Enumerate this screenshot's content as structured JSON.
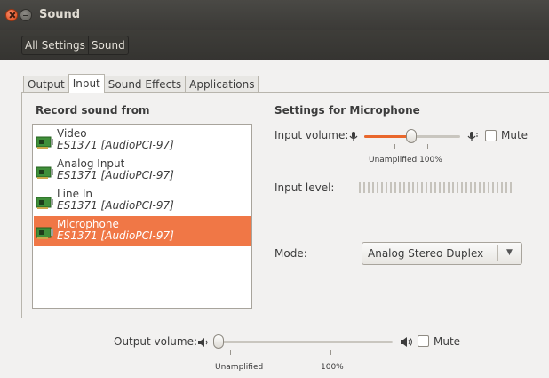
{
  "window": {
    "title": "Sound"
  },
  "breadcrumb": [
    "All Settings",
    "Sound"
  ],
  "tabs": [
    "Output",
    "Input",
    "Sound Effects",
    "Applications"
  ],
  "active_tab": "Input",
  "record": {
    "heading": "Record sound from",
    "devices": [
      {
        "name": "Video",
        "card": "ES1371 [AudioPCI-97]"
      },
      {
        "name": "Analog Input",
        "card": "ES1371 [AudioPCI-97]"
      },
      {
        "name": "Line In",
        "card": "ES1371 [AudioPCI-97]"
      },
      {
        "name": "Microphone",
        "card": "ES1371 [AudioPCI-97]"
      }
    ],
    "selected_index": 3
  },
  "settings": {
    "heading": "Settings for Microphone",
    "input_volume_label": "Input volume:",
    "input_volume_fraction": 0.49,
    "input_scale_label": "Unamplified 100%",
    "mute_label": "Mute",
    "mute_checked": false,
    "input_level_label": "Input level:",
    "mode_label": "Mode:",
    "mode_value": "Analog Stereo Duplex"
  },
  "output": {
    "label": "Output volume:",
    "volume_fraction": 0.02,
    "unamplified_label": "Unamplified",
    "full_label": "100%",
    "mute_label": "Mute",
    "mute_checked": false
  },
  "colors": {
    "accent": "#f07746",
    "slider_fill": "#e9672c",
    "titlebar": "#3c3b37"
  }
}
